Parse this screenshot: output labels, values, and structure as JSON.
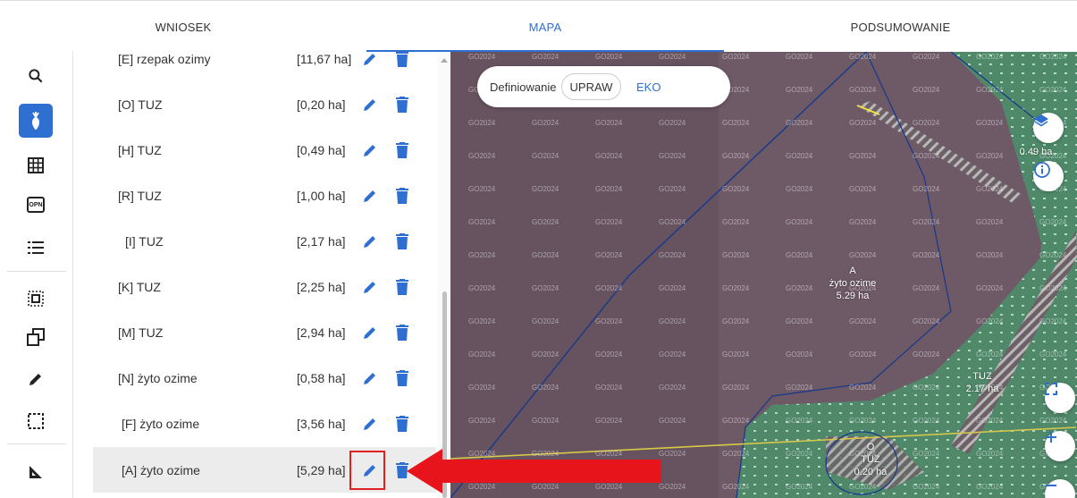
{
  "tabs": [
    {
      "label": "WNIOSEK"
    },
    {
      "label": "MAPA"
    },
    {
      "label": "PODSUMOWANIE"
    }
  ],
  "toolbar": {
    "icons": [
      "search-icon",
      "crop-icon",
      "grid-icon",
      "opn-icon",
      "list-icon",
      "select-area-icon",
      "copy-shape-icon",
      "pencil-icon",
      "dashed-rect-icon",
      "ruler-icon"
    ],
    "opn_text": "OPN"
  },
  "list": {
    "rows": [
      {
        "name": "[E] rzepak ozimy",
        "area": "[11,67 ha]"
      },
      {
        "name": "[O] TUZ",
        "area": "[0,20 ha]"
      },
      {
        "name": "[H] TUZ",
        "area": "[0,49 ha]"
      },
      {
        "name": "[R] TUZ",
        "area": "[1,00 ha]"
      },
      {
        "name": "[I] TUZ",
        "area": "[2,17 ha]"
      },
      {
        "name": "[K] TUZ",
        "area": "[2,25 ha]"
      },
      {
        "name": "[M] TUZ",
        "area": "[2,94 ha]"
      },
      {
        "name": "[N] żyto ozime",
        "area": "[0,58 ha]"
      },
      {
        "name": "[F] żyto ozime",
        "area": "[3,56 ha]"
      },
      {
        "name": "[A] żyto ozime",
        "area": "[5,29 ha]"
      }
    ]
  },
  "map": {
    "toggle": {
      "label": "Definiowanie",
      "option_1": "UPRAW",
      "option_2": "EKO"
    },
    "watermark": "GO2024",
    "labels": {
      "a_code": "A",
      "a_crop": "żyto ozime",
      "a_area": "5.29 ha",
      "tuz_i": "TUZ",
      "tuz_i_area": "2.17 ha",
      "o_code": "O",
      "o_crop": "TUZ",
      "o_area": "0.20 ha",
      "h_area": "0.49 ha"
    }
  },
  "colors": {
    "accent": "#2f6fd1",
    "highlight": "#e02020",
    "arrow": "#e8141b"
  }
}
